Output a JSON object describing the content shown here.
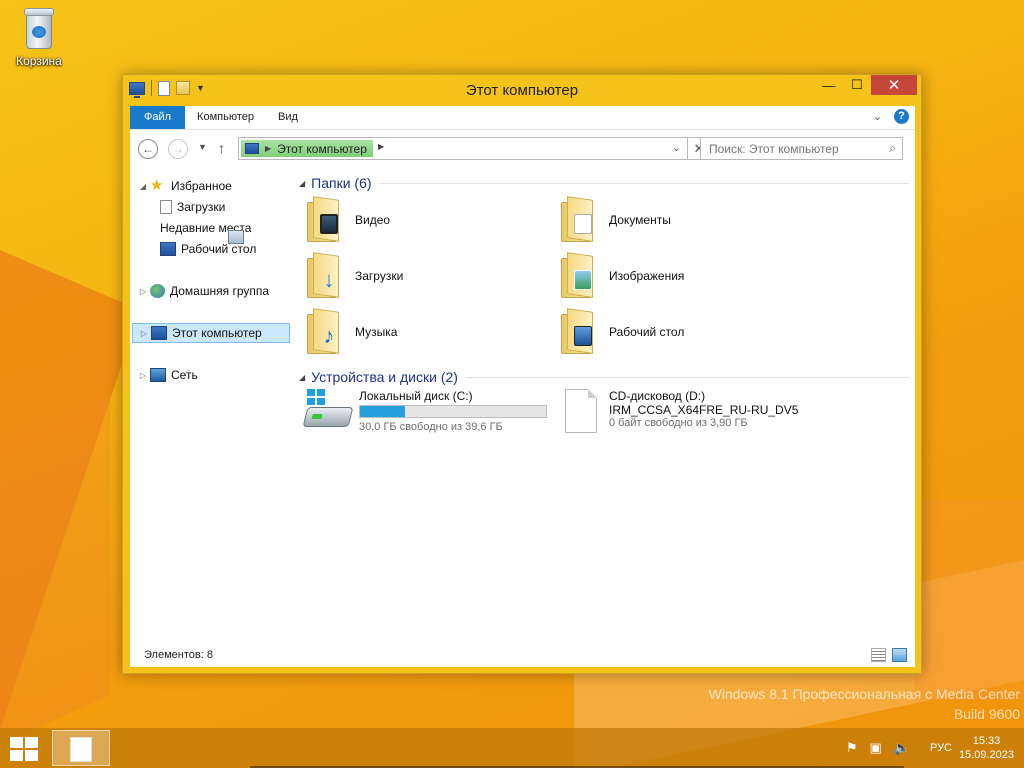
{
  "desktop": {
    "recycle_bin_label": "Корзина",
    "watermark_line1": "Windows 8.1 Профессиональная с Media Center",
    "watermark_line2": "Build 9600"
  },
  "window": {
    "title": "Этот компьютер",
    "buttons": {
      "minimize": "—",
      "maximize": "☐",
      "close": "✕"
    }
  },
  "ribbon": {
    "tabs": [
      {
        "label": "Файл",
        "active": true
      },
      {
        "label": "Компьютер",
        "active": false
      },
      {
        "label": "Вид",
        "active": false
      }
    ],
    "collapse_icon": "chevron-down-icon",
    "help_label": "?"
  },
  "address_bar": {
    "back": "←",
    "forward": "→",
    "up": "↑",
    "path": [
      "Этот компьютер"
    ],
    "clear": "✕"
  },
  "search": {
    "placeholder": "Поиск: Этот компьютер"
  },
  "nav_pane": {
    "favorites": {
      "label": "Избранное",
      "expanded": true,
      "children": [
        "Загрузки",
        "Недавние места",
        "Рабочий стол"
      ]
    },
    "homegroup": {
      "label": "Домашняя группа"
    },
    "computer": {
      "label": "Этот компьютер",
      "selected": true
    },
    "network": {
      "label": "Сеть"
    }
  },
  "content": {
    "folders_group": "Папки (6)",
    "folders": [
      {
        "name": "Видео",
        "icon": "video-folder-icon"
      },
      {
        "name": "Документы",
        "icon": "documents-folder-icon"
      },
      {
        "name": "Загрузки",
        "icon": "downloads-folder-icon"
      },
      {
        "name": "Изображения",
        "icon": "pictures-folder-icon"
      },
      {
        "name": "Музыка",
        "icon": "music-folder-icon"
      },
      {
        "name": "Рабочий стол",
        "icon": "desktop-folder-icon"
      }
    ],
    "devices_group": "Устройства и диски (2)",
    "drives": [
      {
        "name": "Локальный диск (C:)",
        "free_text": "30,0 ГБ свободно из 39,6 ГБ",
        "used_fraction": 0.24,
        "icon": "hard-drive-icon"
      },
      {
        "name": "CD-дисковод (D:)",
        "label": "IRM_CCSA_X64FRE_RU-RU_DV5",
        "free_text": "0 байт свободно из 3,90 ГБ",
        "icon": "cd-drive-icon"
      }
    ]
  },
  "status_bar": {
    "count": "Элементов: 8"
  },
  "taskbar": {
    "language": "РУС",
    "time": "15:33",
    "date": "15.09.2023"
  }
}
